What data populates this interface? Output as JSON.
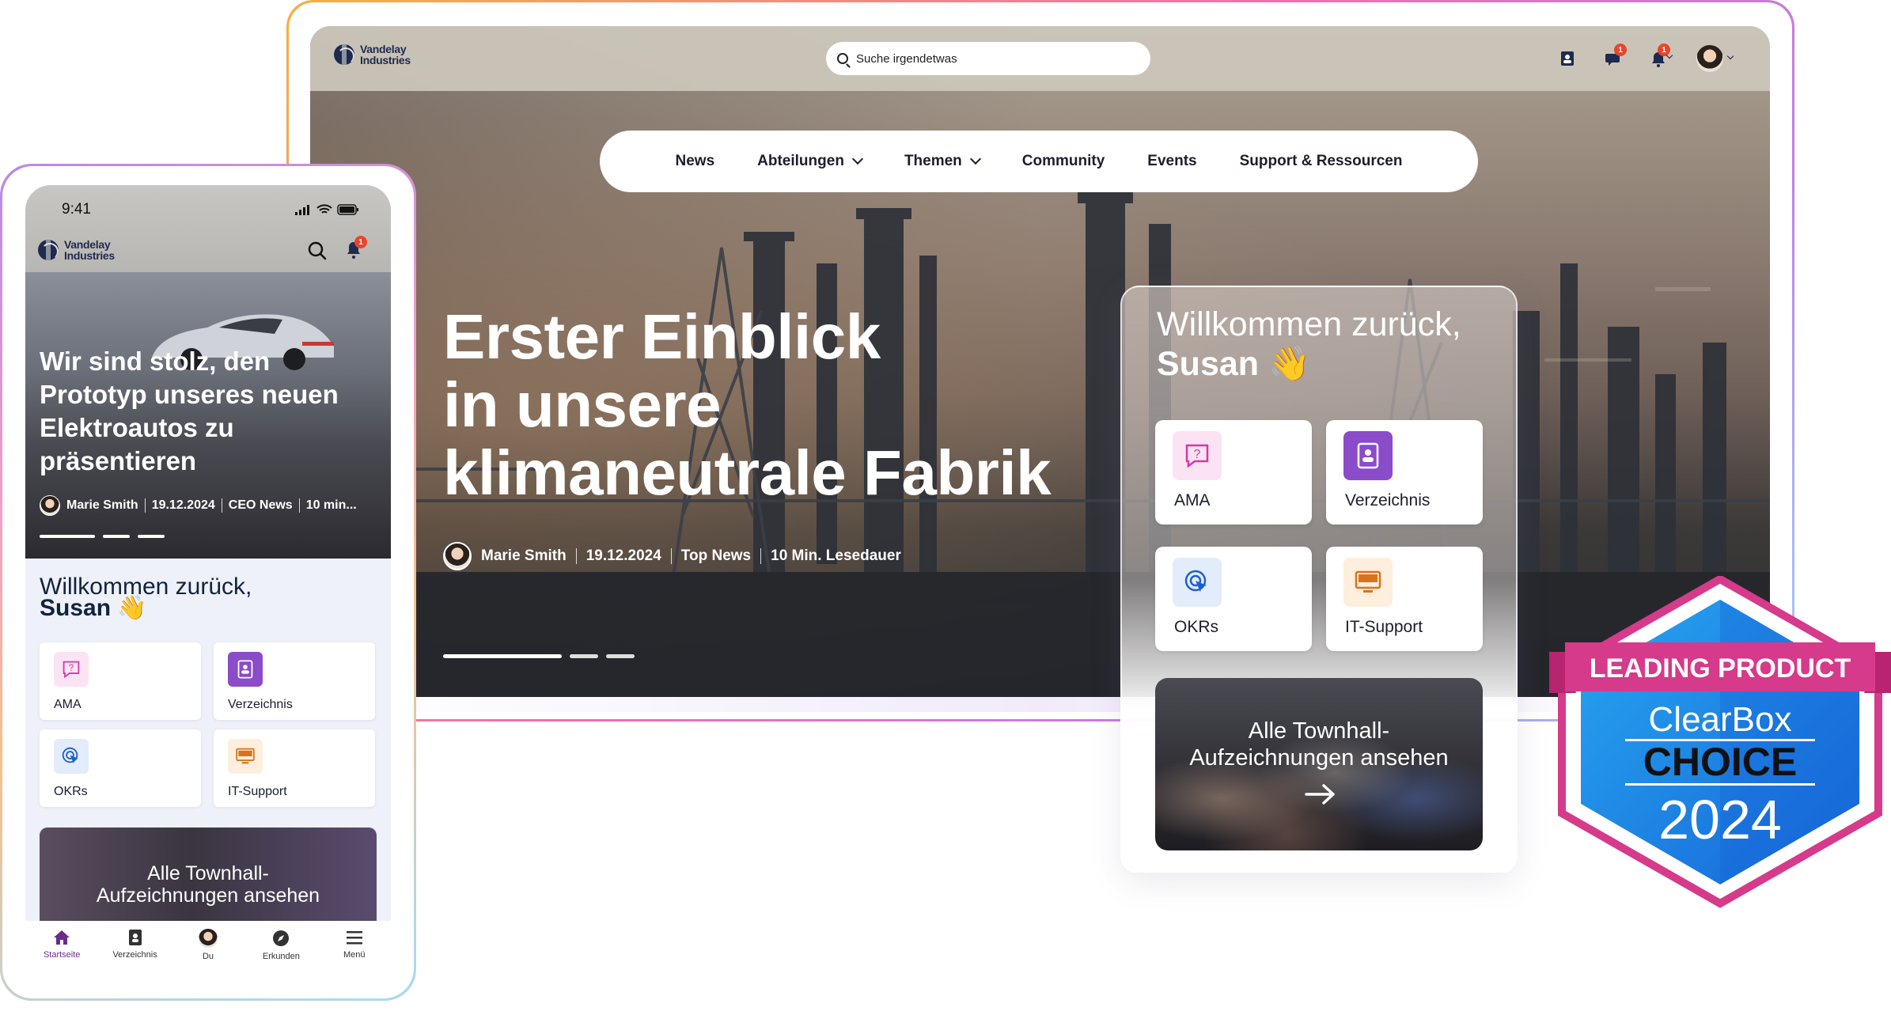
{
  "brand": {
    "name_line1": "Vandelay",
    "name_line2": "Industries"
  },
  "desktop": {
    "search": {
      "placeholder": "Suche irgendetwas"
    },
    "top_icons": [
      {
        "icon": "contacts-icon"
      },
      {
        "icon": "chat-icon",
        "badge": "1"
      },
      {
        "icon": "bell-icon",
        "badge": "1"
      },
      {
        "icon": "profile-avatar"
      }
    ],
    "nav": {
      "items": [
        {
          "label": "News",
          "dropdown": false
        },
        {
          "label": "Abteilungen",
          "dropdown": true
        },
        {
          "label": "Themen",
          "dropdown": true
        },
        {
          "label": "Community",
          "dropdown": false
        },
        {
          "label": "Events",
          "dropdown": false
        },
        {
          "label": "Support & Ressourcen",
          "dropdown": false
        }
      ]
    },
    "hero": {
      "headline_l1": "Erster Einblick",
      "headline_l2": "in unsere",
      "headline_l3": "klimaneutrale Fabrik",
      "author": "Marie Smith",
      "date": "19.12.2024",
      "category": "Top News",
      "read_time": "10 Min. Lesedauer"
    },
    "welcome": {
      "greeting": "Willkommen zurück,",
      "name": "Susan",
      "wave": "👋",
      "tiles": [
        {
          "label": "AMA",
          "icon": "question-icon",
          "color": "#d23aa8",
          "bg": "#fbe3f3"
        },
        {
          "label": "Verzeichnis",
          "icon": "directory-icon",
          "color": "#ffffff",
          "bg": "#8a4cc8"
        },
        {
          "label": "OKRs",
          "icon": "target-cursor-icon",
          "color": "#1e5fd0",
          "bg": "#e3ecfb"
        },
        {
          "label": "IT-Support",
          "icon": "monitor-icon",
          "color": "#d9731b",
          "bg": "#fdeedd"
        }
      ],
      "townhall_l1": "Alle Townhall-",
      "townhall_l2": "Aufzeichnungen ansehen"
    }
  },
  "phone": {
    "time": "9:41",
    "bell_badge": "1",
    "hero": {
      "headline": "Wir sind stolz, den Prototyp unseres neuen Elektroautos zu präsentieren",
      "author": "Marie Smith",
      "date": "19.12.2024",
      "category": "CEO News",
      "read_time": "10 min..."
    },
    "welcome": {
      "greeting": "Willkommen zurück,",
      "name": "Susan",
      "wave": "👋"
    },
    "tiles": [
      {
        "label": "AMA",
        "icon": "question-icon"
      },
      {
        "label": "Verzeichnis",
        "icon": "directory-icon"
      },
      {
        "label": "OKRs",
        "icon": "target-cursor-icon"
      },
      {
        "label": "IT-Support",
        "icon": "monitor-icon"
      }
    ],
    "townhall_l1": "Alle Townhall-",
    "townhall_l2": "Aufzeichnungen ansehen",
    "tabs": [
      {
        "label": "Startseite",
        "icon": "home-icon",
        "active": true
      },
      {
        "label": "Verzeichnis",
        "icon": "directory-icon",
        "active": false
      },
      {
        "label": "Du",
        "icon": "avatar-icon",
        "active": false
      },
      {
        "label": "Erkunden",
        "icon": "compass-icon",
        "active": false
      },
      {
        "label": "Menü",
        "icon": "menu-icon",
        "active": false
      }
    ]
  },
  "award": {
    "ribbon": "LEADING PRODUCT",
    "brand": "ClearBox",
    "word": "CHOICE",
    "year": "2024",
    "colors": {
      "frame": "#d63a8a",
      "ribbon": "#d63a8a",
      "blue_light": "#27a7f0",
      "blue_dark": "#1664d8"
    }
  },
  "colors": {
    "accent_purple": "#6a2b8c",
    "navy": "#1e2a4f",
    "badge_red": "#e9452c"
  }
}
